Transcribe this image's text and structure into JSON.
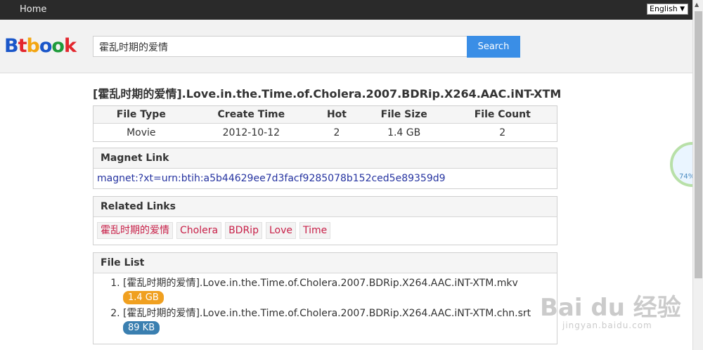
{
  "nav": {
    "home": "Home"
  },
  "language": {
    "selected": "English",
    "arrow": "▼"
  },
  "logo": {
    "letters": [
      {
        "ch": "B",
        "color": "#1a56c9"
      },
      {
        "ch": "t",
        "color": "#e3262d"
      },
      {
        "ch": "b",
        "color": "#f3a512"
      },
      {
        "ch": "o",
        "color": "#1a56c9"
      },
      {
        "ch": "o",
        "color": "#1e9b3b"
      },
      {
        "ch": "k",
        "color": "#e3262d"
      }
    ]
  },
  "search": {
    "value": "霍乱时期的爱情",
    "button": "Search"
  },
  "title": "[霍乱时期的爱情].Love.in.the.Time.of.Cholera.2007.BDRip.X264.AAC.iNT-XTM",
  "info": {
    "headers": [
      "File Type",
      "Create Time",
      "Hot",
      "File Size",
      "File Count"
    ],
    "values": [
      "Movie",
      "2012-10-12",
      "2",
      "1.4 GB",
      "2"
    ]
  },
  "magnet": {
    "heading": "Magnet Link",
    "link": "magnet:?xt=urn:btih:a5b44629ee7d3facf9285078b152ced5e89359d9"
  },
  "related": {
    "heading": "Related Links",
    "tags": [
      "霍乱时期的爱情",
      "Cholera",
      "BDRip",
      "Love",
      "Time"
    ]
  },
  "files": {
    "heading": "File List",
    "items": [
      {
        "name": "[霍乱时期的爱情].Love.in.the.Time.of.Cholera.2007.BDRip.X264.AAC.iNT-XTM.mkv",
        "size": "1.4 GB",
        "color": "#f0a020"
      },
      {
        "name": "[霍乱时期的爱情].Love.in.the.Time.of.Cholera.2007.BDRip.X264.AAC.iNT-XTM.chn.srt",
        "size": "89 KB",
        "color": "#3a7fb0"
      }
    ]
  },
  "widget": {
    "percent": "74%"
  },
  "watermark": {
    "main": "Bai du 经验",
    "sub": "jingyan.baidu.com"
  }
}
